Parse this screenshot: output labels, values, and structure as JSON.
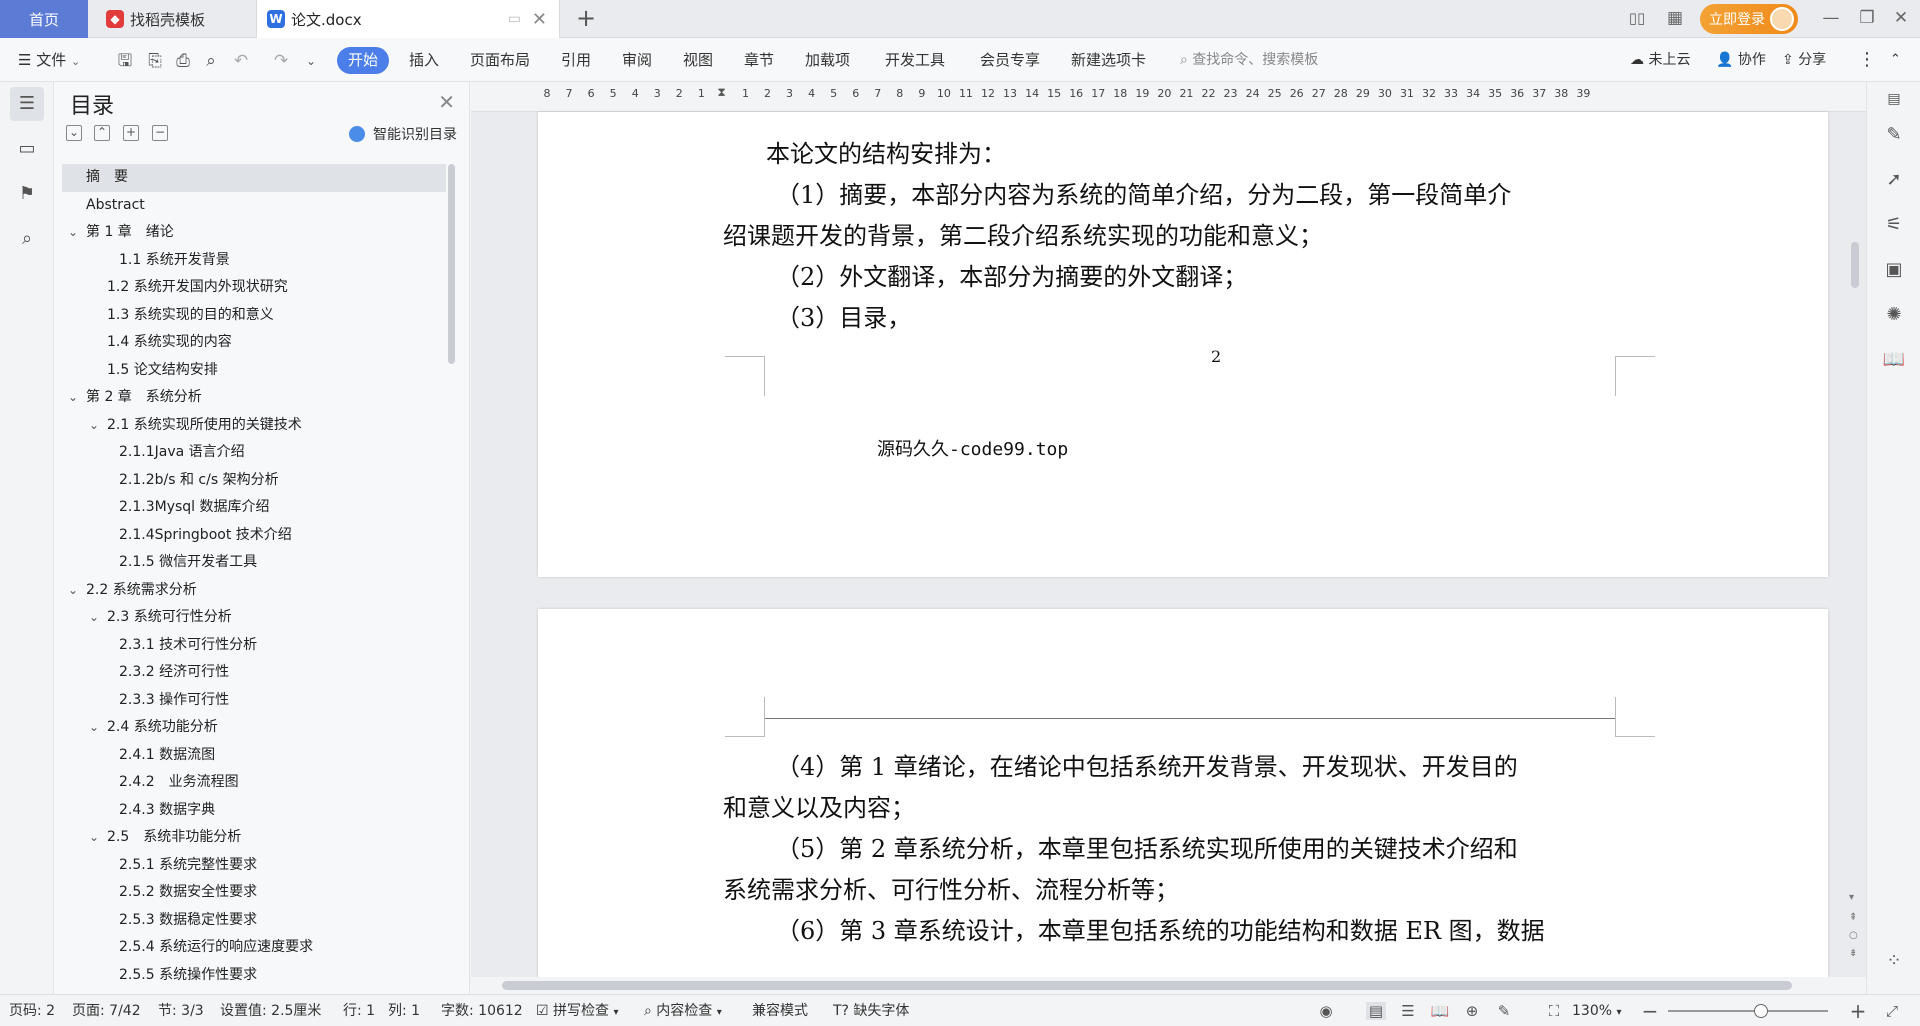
{
  "tabs": {
    "home": "首页",
    "template": "找稻壳模板",
    "doc": "论文.docx"
  },
  "window": {
    "login": "立即登录"
  },
  "ribbon": {
    "file": "文件",
    "items": [
      "开始",
      "插入",
      "页面布局",
      "引用",
      "审阅",
      "视图",
      "章节",
      "加载项",
      "开发工具",
      "会员专享",
      "新建选项卡"
    ],
    "search_placeholder": "查找命令、搜索模板",
    "cloud": "未上云",
    "collab": "协作",
    "share": "分享"
  },
  "toc": {
    "title": "目录",
    "smart": "智能识别目录",
    "items": [
      {
        "label": "摘　要",
        "level": 0,
        "chev": false
      },
      {
        "label": "Abstract",
        "level": 0,
        "chev": false
      },
      {
        "label": "第 1 章　绪论",
        "level": 0,
        "chev": true
      },
      {
        "label": "1.1 系统开发背景",
        "level": 2,
        "chev": false
      },
      {
        "label": "1.2 系统开发国内外现状研究",
        "level": 1,
        "chev": false
      },
      {
        "label": "1.3 系统实现的目的和意义",
        "level": 1,
        "chev": false
      },
      {
        "label": "1.4 系统实现的内容",
        "level": 1,
        "chev": false
      },
      {
        "label": "1.5 论文结构安排",
        "level": 1,
        "chev": false
      },
      {
        "label": "第 2 章　系统分析",
        "level": 0,
        "chev": true
      },
      {
        "label": "2.1 系统实现所使用的关键技术",
        "level": 1,
        "chev": true
      },
      {
        "label": "2.1.1Java 语言介绍",
        "level": 2,
        "chev": false
      },
      {
        "label": "2.1.2b/s 和 c/s 架构分析",
        "level": 2,
        "chev": false
      },
      {
        "label": "2.1.3Mysql 数据库介绍",
        "level": 2,
        "chev": false
      },
      {
        "label": "2.1.4Springboot 技术介绍",
        "level": 2,
        "chev": false
      },
      {
        "label": "2.1.5 微信开发者工具",
        "level": 2,
        "chev": false
      },
      {
        "label": "2.2 系统需求分析",
        "level": 0,
        "chev": true
      },
      {
        "label": "2.3 系统可行性分析",
        "level": 1,
        "chev": true
      },
      {
        "label": "2.3.1 技术可行性分析",
        "level": 2,
        "chev": false
      },
      {
        "label": "2.3.2 经济可行性",
        "level": 2,
        "chev": false
      },
      {
        "label": "2.3.3 操作可行性",
        "level": 2,
        "chev": false
      },
      {
        "label": "2.4 系统功能分析",
        "level": 1,
        "chev": true
      },
      {
        "label": "2.4.1 数据流图",
        "level": 2,
        "chev": false
      },
      {
        "label": "2.4.2　业务流程图",
        "level": 2,
        "chev": false
      },
      {
        "label": "2.4.3 数据字典",
        "level": 2,
        "chev": false
      },
      {
        "label": "2.5　系统非功能分析",
        "level": 1,
        "chev": true
      },
      {
        "label": "2.5.1 系统完整性要求",
        "level": 2,
        "chev": false
      },
      {
        "label": "2.5.2 数据安全性要求",
        "level": 2,
        "chev": false
      },
      {
        "label": "2.5.3 数据稳定性要求",
        "level": 2,
        "chev": false
      },
      {
        "label": "2.5.4 系统运行的响应速度要求",
        "level": 2,
        "chev": false
      },
      {
        "label": "2.5.5 系统操作性要求",
        "level": 2,
        "chev": false
      }
    ]
  },
  "ruler": {
    "ticks": [
      "8",
      "7",
      "6",
      "5",
      "4",
      "3",
      "2",
      "1",
      "",
      "1",
      "2",
      "3",
      "4",
      "5",
      "6",
      "7",
      "8",
      "9",
      "10",
      "11",
      "12",
      "13",
      "14",
      "15",
      "16",
      "17",
      "18",
      "19",
      "20",
      "21",
      "22",
      "23",
      "24",
      "25",
      "26",
      "27",
      "28",
      "29",
      "30",
      "31",
      "32",
      "33",
      "34",
      "35",
      "36",
      "37",
      "38",
      "39"
    ]
  },
  "page1": {
    "lines": [
      "本论文的结构安排为：",
      "（1）摘要，本部分内容为系统的简单介绍，分为二段，第一段简单介",
      "绍课题开发的背景，第二段介绍系统实现的功能和意义；",
      "（2）外文翻译，本部分为摘要的外文翻译；",
      "（3）目录，"
    ],
    "page_number": "2",
    "footer": "源码久久-code99.top"
  },
  "page2": {
    "lines": [
      "（4）第 1 章绪论，在绪论中包括系统开发背景、开发现状、开发目的",
      "和意义以及内容；",
      "（5）第 2 章系统分析，本章里包括系统实现所使用的关键技术介绍和",
      "系统需求分析、可行性分析、流程分析等；",
      "（6）第 3 章系统设计，本章里包括系统的功能结构和数据 ER 图，数据"
    ]
  },
  "status": {
    "page_no": "页码: 2",
    "page": "页面: 7/42",
    "section": "节: 3/3",
    "setting": "设置值: 2.5厘米",
    "row": "行: 1",
    "col": "列: 1",
    "words": "字数: 10612",
    "spell": "拼写检查",
    "content": "内容检查",
    "compat": "兼容模式",
    "missing_font": "缺失字体",
    "zoom": "130%"
  }
}
